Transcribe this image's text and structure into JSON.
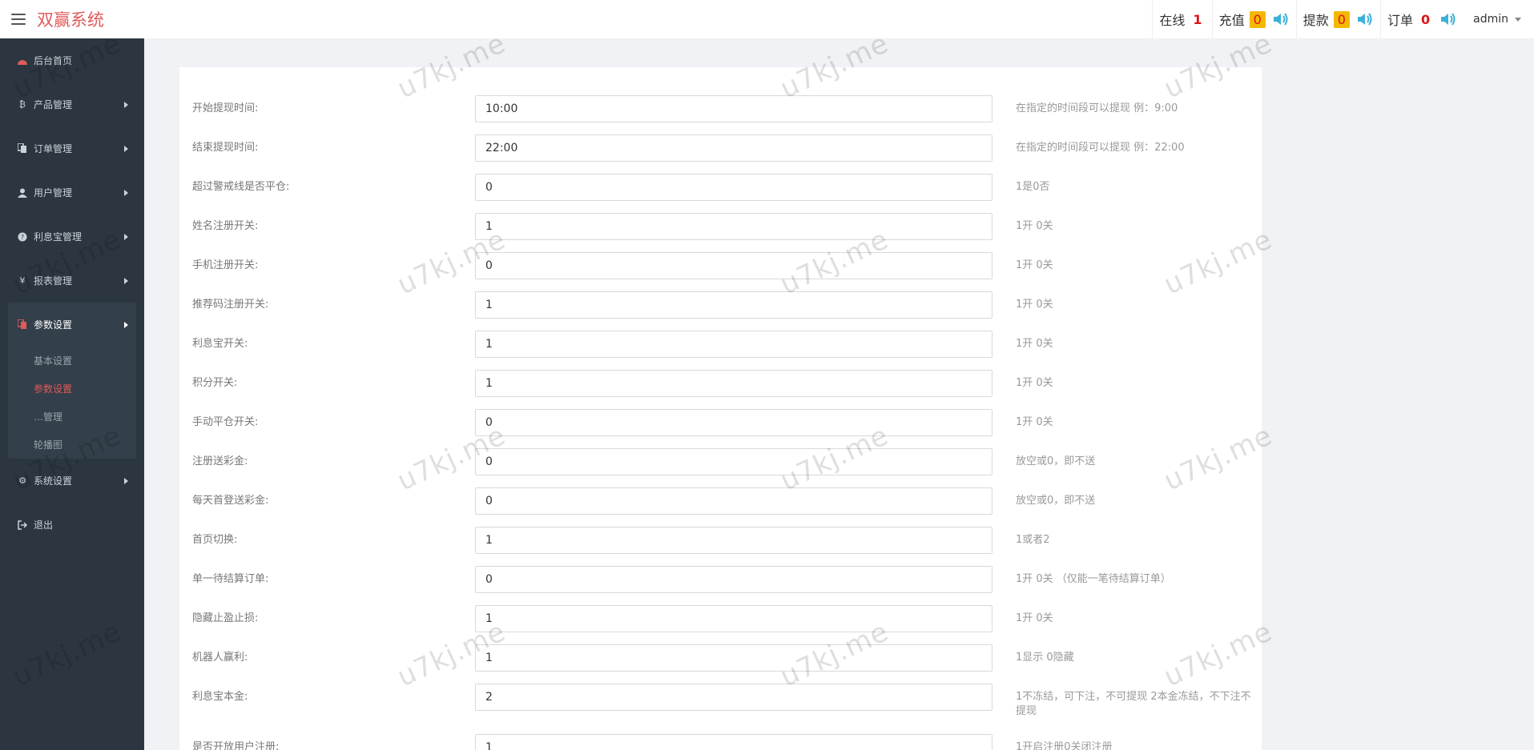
{
  "app": {
    "brand": "双赢系统"
  },
  "header": {
    "online": {
      "label": "在线",
      "count": "1"
    },
    "recharge": {
      "label": "充值",
      "count": "0"
    },
    "withdraw": {
      "label": "提款",
      "count": "0"
    },
    "orders": {
      "label": "订单",
      "count": "0"
    },
    "user": "admin"
  },
  "sidebar": {
    "items": [
      {
        "label": "后台首页",
        "icon": "dashboard-icon"
      },
      {
        "label": "产品管理",
        "icon": "bitcoin-icon"
      },
      {
        "label": "订单管理",
        "icon": "copy-icon"
      },
      {
        "label": "用户管理",
        "icon": "user-icon"
      },
      {
        "label": "利息宝管理",
        "icon": "circle-question-icon"
      },
      {
        "label": "报表管理",
        "icon": "yen-icon"
      },
      {
        "label": "参数设置",
        "icon": "copy-icon"
      },
      {
        "label": "系统设置",
        "icon": "cogs-icon"
      },
      {
        "label": "退出",
        "icon": "sign-out-icon"
      }
    ],
    "sub_items": [
      "基本设置",
      "参数设置",
      "…管理",
      "轮播图"
    ]
  },
  "form": {
    "rows": [
      {
        "label": "开始提现时间:",
        "value": "10:00",
        "hint": "在指定的时间段可以提现 例：9:00"
      },
      {
        "label": "结束提现时间:",
        "value": "22:00",
        "hint": "在指定的时间段可以提现 例：22:00"
      },
      {
        "label": "超过警戒线是否平仓:",
        "value": "0",
        "hint": "1是0否"
      },
      {
        "label": "姓名注册开关:",
        "value": "1",
        "hint": "1开 0关"
      },
      {
        "label": "手机注册开关:",
        "value": "0",
        "hint": "1开 0关"
      },
      {
        "label": "推荐码注册开关:",
        "value": "1",
        "hint": "1开 0关"
      },
      {
        "label": "利息宝开关:",
        "value": "1",
        "hint": "1开 0关"
      },
      {
        "label": "积分开关:",
        "value": "1",
        "hint": "1开 0关"
      },
      {
        "label": "手动平仓开关:",
        "value": "0",
        "hint": "1开 0关"
      },
      {
        "label": "注册送彩金:",
        "value": "0",
        "hint": "放空或0，即不送"
      },
      {
        "label": "每天首登送彩金:",
        "value": "0",
        "hint": "放空或0，即不送"
      },
      {
        "label": "首页切换:",
        "value": "1",
        "hint": "1或者2"
      },
      {
        "label": "单一待结算订单:",
        "value": "0",
        "hint": "1开 0关 （仅能一笔待结算订单）"
      },
      {
        "label": "隐藏止盈止损:",
        "value": "1",
        "hint": "1开 0关"
      },
      {
        "label": "机器人赢利:",
        "value": "1",
        "hint": "1显示 0隐藏"
      },
      {
        "label": "利息宝本金:",
        "value": "2",
        "hint": "1不冻结，可下注，不可提现 2本金冻结，不下注不提现"
      },
      {
        "label": "是否开放用户注册:",
        "value": "1",
        "hint": "1开启注册0关闭注册"
      }
    ]
  },
  "watermark": "u7kj.me",
  "colors": {
    "brand": "#e05a5a",
    "sidebar": "#2b3640",
    "badge": "#f5b800",
    "badge_text": "#d9141c",
    "speaker": "#3bb1d8"
  }
}
